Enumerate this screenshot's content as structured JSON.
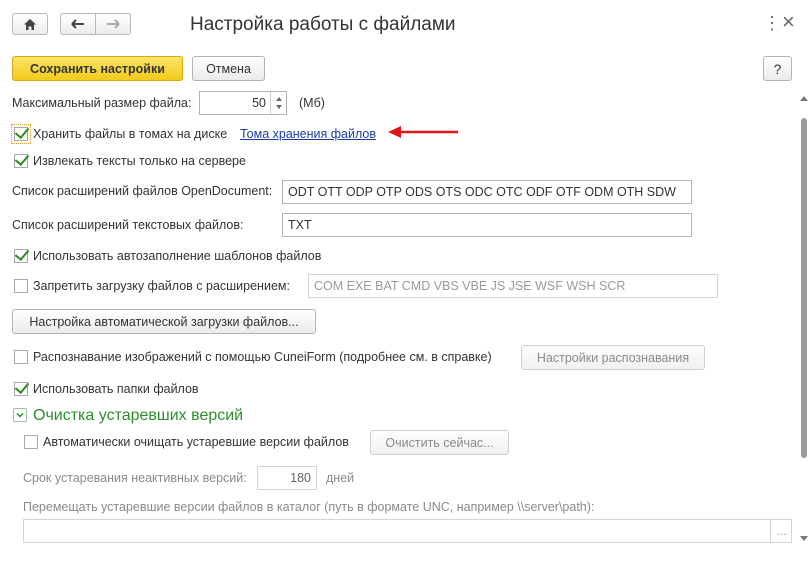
{
  "window": {
    "title": "Настройка работы с файлами",
    "more_symbol": "⋮",
    "close_symbol": "×"
  },
  "toolbar": {
    "save_label": "Сохранить настройки",
    "cancel_label": "Отмена",
    "help_label": "?"
  },
  "max_size": {
    "label": "Максимальный размер файла:",
    "value": "50",
    "unit": "(Мб)"
  },
  "store_volumes": {
    "label": "Хранить файлы в томах на диске",
    "checked": true,
    "link": "Тома хранения файлов"
  },
  "extract_text": {
    "label": "Извлекать тексты только на сервере",
    "checked": true
  },
  "opendoc_ext": {
    "label": "Список расширений файлов OpenDocument:",
    "value": "ODT OTT ODP OTP ODS OTS ODC OTC ODF OTF ODM OTH SDW"
  },
  "text_ext": {
    "label": "Список расширений текстовых файлов:",
    "value": "TXT"
  },
  "autofill": {
    "label": "Использовать автозаполнение шаблонов файлов",
    "checked": true
  },
  "forbid_ext": {
    "label": "Запретить загрузку файлов с расширением:",
    "checked": false,
    "value": "COM EXE BAT CMD VBS VBE JS JSE WSF WSH SCR"
  },
  "autoload_button": "Настройка автоматической загрузки файлов...",
  "recognition": {
    "label": "Распознавание изображений с помощью CuneiForm (подробнее см. в справке)",
    "checked": false,
    "button": "Настройки распознавания"
  },
  "folders": {
    "label": "Использовать папки файлов",
    "checked": true
  },
  "cleanup": {
    "section_title": "Очистка устаревших версий",
    "auto_label": "Автоматически очищать устаревшие версии файлов",
    "auto_checked": false,
    "clean_now": "Очистить сейчас...",
    "inactive_label": "Срок устаревания неактивных версий:",
    "inactive_value": "180",
    "inactive_unit": "дней",
    "move_label": "Перемещать устаревшие версии файлов в каталог (путь в формате UNC, например \\\\server\\path):",
    "move_value": "",
    "browse": "..."
  }
}
